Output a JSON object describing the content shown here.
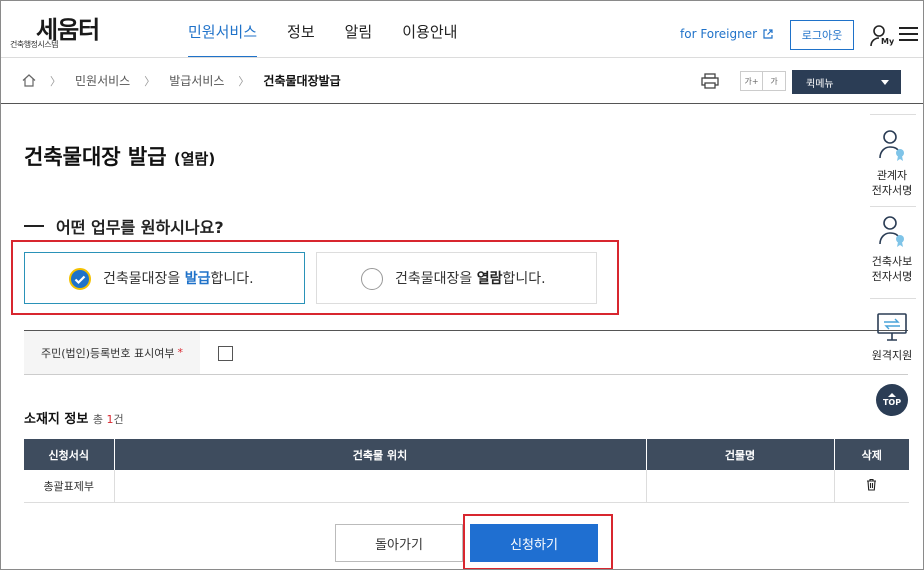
{
  "header": {
    "logo_text": "세움터",
    "logo_sub": "건축행정시스템",
    "nav": [
      "민원서비스",
      "정보",
      "알림",
      "이용안내"
    ],
    "foreigner_link": "for Foreigner",
    "login_label": "로그아웃",
    "my_label": "My"
  },
  "breadcrumb": [
    "민원서비스",
    "발급서비스",
    "건축물대장발급"
  ],
  "toolbar": {
    "font_increase": "가+",
    "font_decrease": "가",
    "quick_menu": "퀵메뉴"
  },
  "page": {
    "title": "건축물대장 발급",
    "title_sub": "(열람)",
    "question": "어떤 업무를 원하시나요?",
    "option_issue": {
      "pre": "건축물대장을 ",
      "em": "발급",
      "post": "합니다."
    },
    "option_view": {
      "pre": "건축물대장을 ",
      "em": "열람",
      "post": "합니다."
    },
    "resident_label": "주민(법인)등록번호 표시여부",
    "resident_required": "*",
    "location_title": "소재지 정보",
    "location_count_pre": "총 ",
    "location_count": "1",
    "location_count_post": "건"
  },
  "table": {
    "headers": [
      "신청서식",
      "건축물 위치",
      "건물명",
      "삭제"
    ],
    "rows": [
      {
        "form": "총괄표제부",
        "location": "",
        "building": ""
      }
    ]
  },
  "buttons": {
    "back": "돌아가기",
    "apply": "신청하기"
  },
  "side": {
    "stakeholder": [
      "관계자",
      "전자서명"
    ],
    "inspector": [
      "건축사보",
      "전자서명"
    ],
    "remote": "원격지원",
    "top": "TOP"
  },
  "colors": {
    "accent": "#1f72c9",
    "highlight": "#d8262f",
    "dark": "#3e4c5e"
  }
}
